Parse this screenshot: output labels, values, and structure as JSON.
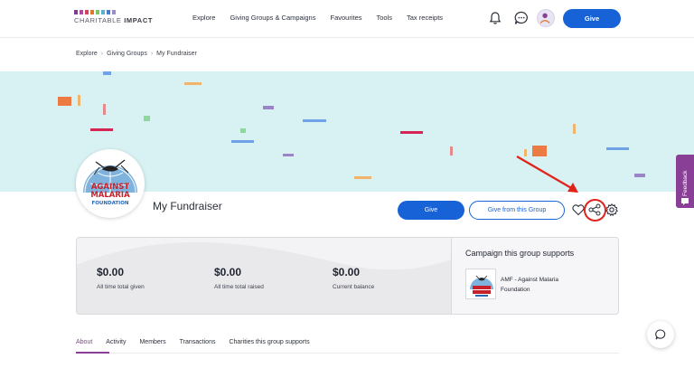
{
  "header": {
    "logo": {
      "word1": "CHARITABLE",
      "word2": "IMPACT",
      "bar_colors": [
        "#7a3e8c",
        "#b04a9e",
        "#d8415f",
        "#e0762d",
        "#7cc46a",
        "#56b3c9",
        "#4b7bd1",
        "#9c8cc8"
      ]
    },
    "nav": [
      "Explore",
      "Giving Groups & Campaigns",
      "Favourites",
      "Tools",
      "Tax receipts"
    ],
    "give_label": "Give",
    "icons": [
      "bell-icon",
      "chat-icon",
      "user-avatar"
    ]
  },
  "breadcrumb": [
    "Explore",
    "Giving Groups",
    "My Fundraiser"
  ],
  "fundraiser": {
    "title": "My Fundraiser",
    "logo_text": [
      "AGAINST",
      "MALARIA",
      "FOUNDATION"
    ],
    "give_label": "Give",
    "give_from_group_label": "Give from this Group",
    "icons": [
      "heart-icon",
      "share-icon",
      "settings-icon"
    ]
  },
  "stats": [
    {
      "value": "$0.00",
      "label": "All time total given"
    },
    {
      "value": "$0.00",
      "label": "All time total raised"
    },
    {
      "value": "$0.00",
      "label": "Current balance"
    }
  ],
  "campaign": {
    "heading": "Campaign this group supports",
    "name": "AMF - Against Malaria Foundation"
  },
  "tabs": [
    "About",
    "Activity",
    "Members",
    "Transactions",
    "Charities this group supports"
  ],
  "active_tab": "About",
  "feedback_label": "Feedback",
  "colors": {
    "primary_blue": "#1762d6",
    "accent_purple": "#8a3f97",
    "banner_bg": "#d8f1f2",
    "annotation_red": "#e0241b"
  }
}
